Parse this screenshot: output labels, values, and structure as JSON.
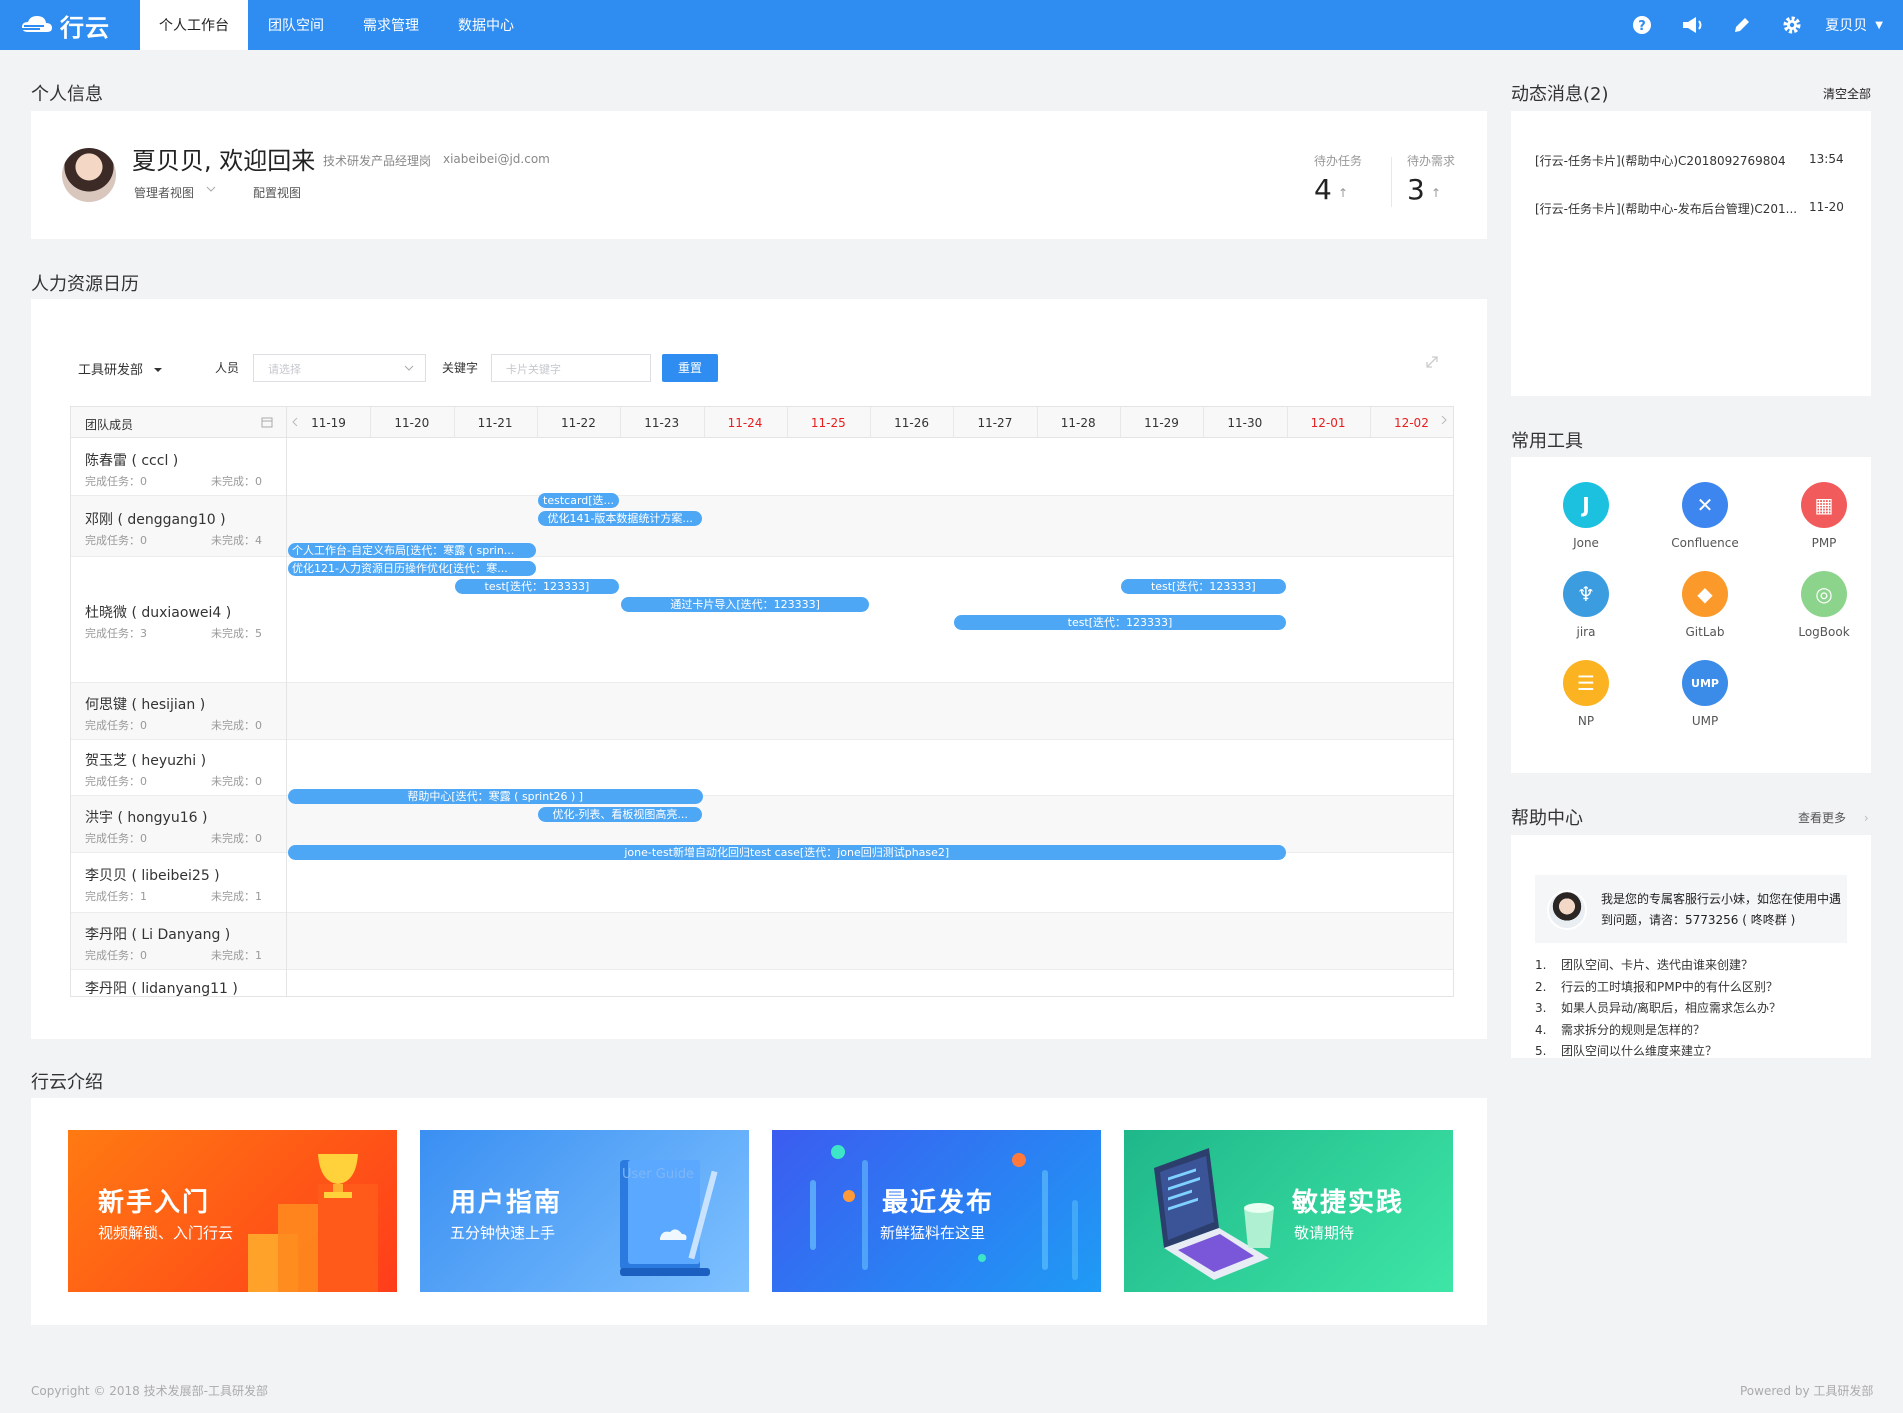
{
  "app": {
    "logo_text": "行云"
  },
  "nav": {
    "items": [
      "个人工作台",
      "团队空间",
      "需求管理",
      "数据中心"
    ]
  },
  "header": {
    "user_name": "夏贝贝",
    "caret": "▼"
  },
  "profile": {
    "section_title": "个人信息",
    "greeting": "夏贝贝, 欢迎回来",
    "role": "技术研发产品经理岗",
    "email": "xiabeibei@jd.com",
    "view_manager": "管理者视图",
    "view_config": "配置视图",
    "pending_tasks_label": "待办任务",
    "pending_tasks_count": "4",
    "pending_reqs_label": "待办需求",
    "pending_reqs_count": "3",
    "up_glyph": "↑"
  },
  "calendar": {
    "section_title": "人力资源日历",
    "dept": "工具研发部",
    "people_label": "人员",
    "people_placeholder": "请选择",
    "keyword_label": "关键字",
    "keyword_placeholder": "卡片关键字",
    "reset_label": "重置",
    "member_col_header": "团队成员",
    "dates": [
      {
        "label": "11-19",
        "weekend": false
      },
      {
        "label": "11-20",
        "weekend": false
      },
      {
        "label": "11-21",
        "weekend": false
      },
      {
        "label": "11-22",
        "weekend": false
      },
      {
        "label": "11-23",
        "weekend": false
      },
      {
        "label": "11-24",
        "weekend": true
      },
      {
        "label": "11-25",
        "weekend": true
      },
      {
        "label": "11-26",
        "weekend": false
      },
      {
        "label": "11-27",
        "weekend": false
      },
      {
        "label": "11-28",
        "weekend": false
      },
      {
        "label": "11-29",
        "weekend": false
      },
      {
        "label": "11-30",
        "weekend": false
      },
      {
        "label": "12-01",
        "weekend": true
      },
      {
        "label": "12-02",
        "weekend": true
      }
    ],
    "members": [
      {
        "name": "陈春雷 ( cccl )",
        "done": "完成任务：0",
        "undone": "未完成：0"
      },
      {
        "name": "邓刚 ( denggang10 )",
        "done": "完成任务：0",
        "undone": "未完成：4"
      },
      {
        "name": "杜晓微 ( duxiaowei4 )",
        "done": "完成任务：3",
        "undone": "未完成：5"
      },
      {
        "name": "何思键 ( hesijian )",
        "done": "完成任务：0",
        "undone": "未完成：0"
      },
      {
        "name": "贺玉芝 ( heyuzhi )",
        "done": "完成任务：0",
        "undone": "未完成：0"
      },
      {
        "name": "洪宇 ( hongyu16 )",
        "done": "完成任务：0",
        "undone": "未完成：0"
      },
      {
        "name": "李贝贝 ( libeibei25 )",
        "done": "完成任务：1",
        "undone": "未完成：1"
      },
      {
        "name": "李丹阳 ( Li Danyang )",
        "done": "完成任务：0",
        "undone": "未完成：1"
      },
      {
        "name": "李丹阳 ( lidanyang11 )",
        "done": "",
        "undone": ""
      }
    ],
    "cards": [
      {
        "text": "testcard[迭...",
        "start": "11-22",
        "end": "11-22"
      },
      {
        "text": "优化141-版本数据统计方案...",
        "start": "11-22",
        "end": "11-23"
      },
      {
        "text": "个人工作台-自定义布局[迭代：寒露 ( sprin...",
        "start": "11-19",
        "end": "11-21"
      },
      {
        "text": "优化121-人力资源日历操作优化[迭代：寒...",
        "start": "11-19",
        "end": "11-21"
      },
      {
        "text": "test[迭代：123333]",
        "start": "11-21",
        "end": "11-22"
      },
      {
        "text": "test[迭代：123333]",
        "start": "11-29",
        "end": "11-30"
      },
      {
        "text": "通过卡片导入[迭代：123333]",
        "start": "11-23",
        "end": "11-25"
      },
      {
        "text": "test[迭代：123333]",
        "start": "11-27",
        "end": "11-30"
      },
      {
        "text": "帮助中心[迭代：寒露 ( sprint26 ) ]",
        "start": "11-19",
        "end": "11-23"
      },
      {
        "text": "优化-列表、看板视图高亮...",
        "start": "11-22",
        "end": "11-23"
      },
      {
        "text": "jone-test新增自动化回归test case[迭代：jone回归测试phase2]",
        "start": "11-19",
        "end": "11-30"
      }
    ]
  },
  "messages": {
    "section_title": "动态消息(2)",
    "clear_all": "清空全部",
    "items": [
      {
        "text": "[行云-任务卡片](帮助中心)C2018092769804",
        "time": "13:54"
      },
      {
        "text": "[行云-任务卡片](帮助中心-发布后台管理)C201...",
        "time": "11-20"
      }
    ]
  },
  "tools": {
    "section_title": "常用工具",
    "items": [
      {
        "label": "Jone",
        "glyph": "J",
        "color": "#1cc1e0"
      },
      {
        "label": "Confluence",
        "glyph": "✕",
        "color": "#3d86f0"
      },
      {
        "label": "PMP",
        "glyph": "▦",
        "color": "#f25b5b"
      },
      {
        "label": "jira",
        "glyph": "♆",
        "color": "#3b9de0"
      },
      {
        "label": "GitLab",
        "glyph": "◆",
        "color": "#fb9a2b"
      },
      {
        "label": "LogBook",
        "glyph": "◎",
        "color": "#8cd48b"
      },
      {
        "label": "NP",
        "glyph": "☰",
        "color": "#fbb321"
      },
      {
        "label": "UMP",
        "glyph": "UMP",
        "color": "#3b8be8"
      }
    ]
  },
  "help": {
    "section_title": "帮助中心",
    "more": "查看更多",
    "more_arrow": "›",
    "bubble_text": "我是您的专属客服行云小妹，如您在使用中遇到问题，请咨：5773256 ( 咚咚群 )",
    "faqs": [
      {
        "num": "1.",
        "text": "团队空间、卡片、迭代由谁来创建？"
      },
      {
        "num": "2.",
        "text": "行云的工时填报和PMP中的有什么区别？"
      },
      {
        "num": "3.",
        "text": "如果人员异动/离职后，相应需求怎么办？"
      },
      {
        "num": "4.",
        "text": "需求拆分的规则是怎样的？"
      },
      {
        "num": "5.",
        "text": "团队空间以什么维度来建立？"
      }
    ]
  },
  "intro": {
    "section_title": "行云介绍",
    "banners": [
      {
        "title": "新手入门",
        "sub": "视频解锁、入门行云",
        "color_a": "#ff7a12",
        "color_b": "#ff3d1a"
      },
      {
        "title": "用户指南",
        "sub": "五分钟快速上手",
        "color_a": "#3a8ff2",
        "color_b": "#7ec1ff",
        "book_text": "User Guide"
      },
      {
        "title": "最近发布",
        "sub": "新鲜猛料在这里",
        "color_a": "#3b5cf0",
        "color_b": "#1f9bf5"
      },
      {
        "title": "敏捷实践",
        "sub": "敬请期待",
        "color_a": "#1fb78a",
        "color_b": "#3ee6a6"
      }
    ]
  },
  "footer": {
    "copyright": "Copyright © 2018 技术发展部-工具研发部",
    "powered": "Powered by 工具研发部"
  }
}
